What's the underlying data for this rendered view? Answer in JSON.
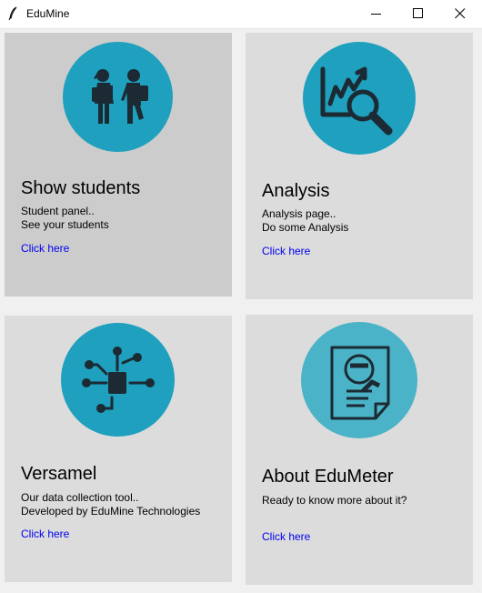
{
  "window": {
    "title": "EduMine",
    "app_icon": "feather-icon",
    "controls": [
      "minimize-icon",
      "maximize-icon",
      "close-icon"
    ]
  },
  "colors": {
    "accent_circle": "#1ea0be",
    "card_background": "#dcdcdc",
    "card_hover_background": "#cccccc",
    "link": "#0000ee"
  },
  "cards": [
    {
      "icon": "students-icon",
      "title": "Show students",
      "desc_line1": "Student panel..",
      "desc_line2": "See your students",
      "link": "Click here"
    },
    {
      "icon": "analysis-icon",
      "title": "Analysis",
      "desc_line1": "Analysis page..",
      "desc_line2": "Do some Analysis",
      "link": "Click here"
    },
    {
      "icon": "network-icon",
      "title": "Versamel",
      "desc_line1": "Our data collection tool..",
      "desc_line2": "Developed by EduMine Technologies",
      "link": "Click here"
    },
    {
      "icon": "profile-document-icon",
      "title": "About EduMeter",
      "desc_line1": "Ready to know more about it?",
      "link": "Click here"
    }
  ]
}
